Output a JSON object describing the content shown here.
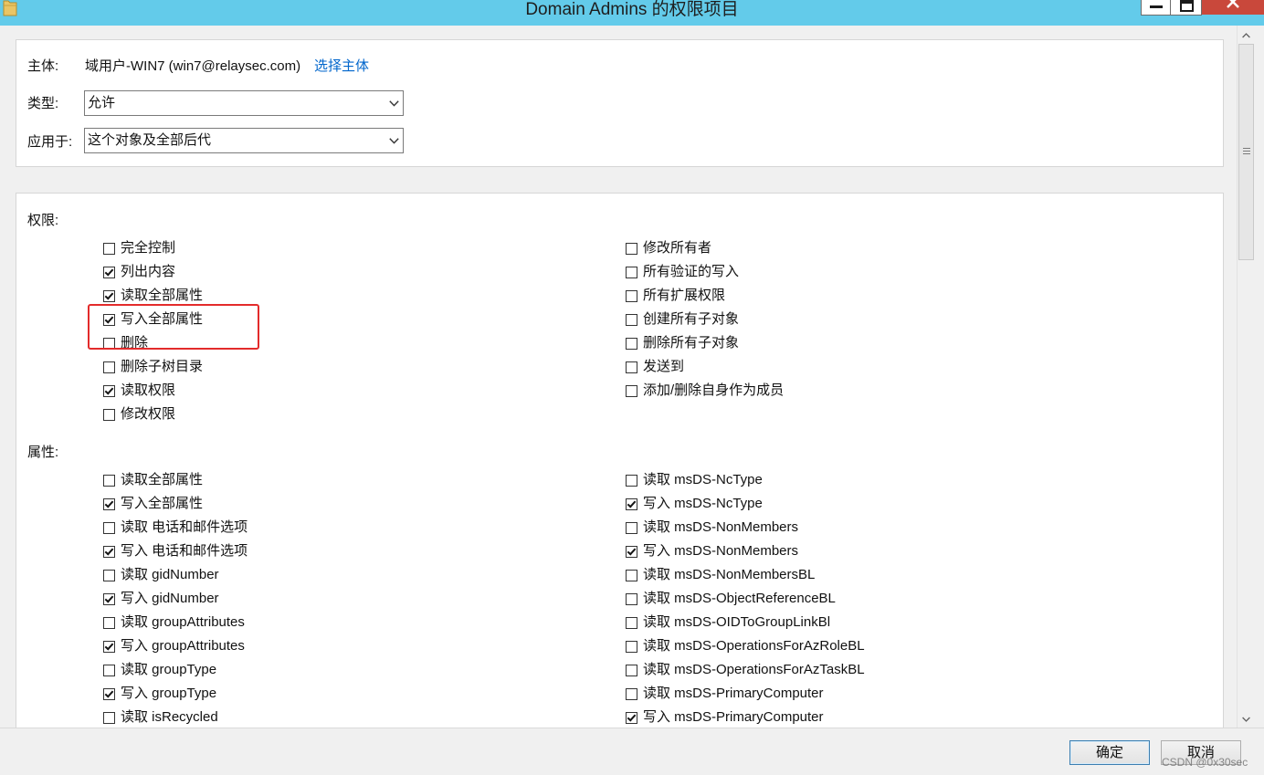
{
  "window": {
    "title": "Domain Admins 的权限项目"
  },
  "icons": {
    "app": "folder-icon",
    "minimize": "minimize-icon",
    "maximize": "maximize-icon",
    "close": "close-icon",
    "dropdown": "chevron-down-icon",
    "scroll_up": "chevron-up-icon",
    "scroll_down": "chevron-down-icon",
    "scroll_grip": "grip-icon"
  },
  "colors": {
    "title_bar": "#63cbea",
    "close_button": "#c9483b",
    "link": "#0066cc",
    "annotation": "#e32b2b",
    "panel_background": "#ffffff",
    "dialog_background": "#f0f0f0"
  },
  "principal": {
    "label": "主体:",
    "value": "域用户-WIN7 (win7@relaysec.com)",
    "select_link": "选择主体"
  },
  "type": {
    "label": "类型:",
    "selected": "允许"
  },
  "applies_to": {
    "label": "应用于:",
    "selected": "这个对象及全部后代"
  },
  "permissions": {
    "label": "权限:",
    "left": [
      {
        "label": "完全控制",
        "checked": false
      },
      {
        "label": "列出内容",
        "checked": true
      },
      {
        "label": "读取全部属性",
        "checked": true
      },
      {
        "label": "写入全部属性",
        "checked": true
      },
      {
        "label": "删除",
        "checked": false
      },
      {
        "label": "删除子树目录",
        "checked": false
      },
      {
        "label": "读取权限",
        "checked": true
      },
      {
        "label": "修改权限",
        "checked": false
      }
    ],
    "right": [
      {
        "label": "修改所有者",
        "checked": false
      },
      {
        "label": "所有验证的写入",
        "checked": false
      },
      {
        "label": "所有扩展权限",
        "checked": false
      },
      {
        "label": "创建所有子对象",
        "checked": false
      },
      {
        "label": "删除所有子对象",
        "checked": false
      },
      {
        "label": "发送到",
        "checked": false
      },
      {
        "label": "添加/删除自身作为成员",
        "checked": false
      }
    ]
  },
  "properties": {
    "label": "属性:",
    "left": [
      {
        "label": "读取全部属性",
        "checked": false
      },
      {
        "label": "写入全部属性",
        "checked": true
      },
      {
        "label": "读取 电话和邮件选项",
        "checked": false
      },
      {
        "label": "写入 电话和邮件选项",
        "checked": true
      },
      {
        "label": "读取 gidNumber",
        "checked": false
      },
      {
        "label": "写入 gidNumber",
        "checked": true
      },
      {
        "label": "读取 groupAttributes",
        "checked": false
      },
      {
        "label": "写入 groupAttributes",
        "checked": true
      },
      {
        "label": "读取 groupType",
        "checked": false
      },
      {
        "label": "写入 groupType",
        "checked": true
      },
      {
        "label": "读取 isRecycled",
        "checked": false
      }
    ],
    "right": [
      {
        "label": "读取 msDS-NcType",
        "checked": false
      },
      {
        "label": "写入 msDS-NcType",
        "checked": true
      },
      {
        "label": "读取 msDS-NonMembers",
        "checked": false
      },
      {
        "label": "写入 msDS-NonMembers",
        "checked": true
      },
      {
        "label": "读取 msDS-NonMembersBL",
        "checked": false
      },
      {
        "label": "读取 msDS-ObjectReferenceBL",
        "checked": false
      },
      {
        "label": "读取 msDS-OIDToGroupLinkBl",
        "checked": false
      },
      {
        "label": "读取 msDS-OperationsForAzRoleBL",
        "checked": false
      },
      {
        "label": "读取 msDS-OperationsForAzTaskBL",
        "checked": false
      },
      {
        "label": "读取 msDS-PrimaryComputer",
        "checked": false
      },
      {
        "label": "写入 msDS-PrimaryComputer",
        "checked": true
      }
    ]
  },
  "buttons": {
    "ok": "确定",
    "cancel": "取消"
  },
  "watermark": "CSDN @0x30sec"
}
